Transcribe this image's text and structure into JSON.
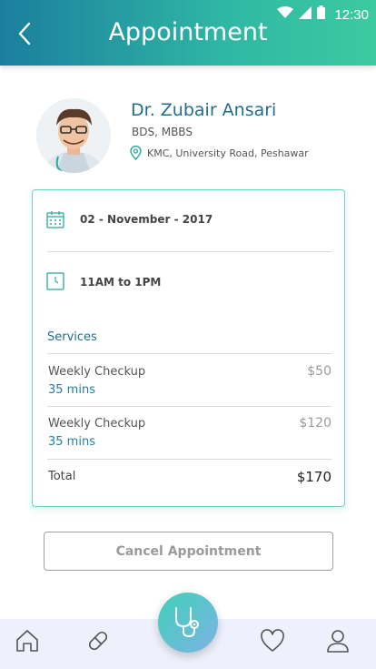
{
  "status_bar": {
    "time": "12:30"
  },
  "header": {
    "title": "Appointment"
  },
  "doctor": {
    "name": "Dr. Zubair Ansari",
    "degree": "BDS, MBBS",
    "location": "KMC, University Road, Peshawar"
  },
  "appointment": {
    "date": "02 - November - 2017",
    "time": "11AM to 1PM"
  },
  "services": {
    "title": "Services",
    "items": [
      {
        "name": "Weekly Checkup",
        "duration": "35 mins",
        "price": "$50"
      },
      {
        "name": "Weekly Checkup",
        "duration": "35 mins",
        "price": "$120"
      }
    ],
    "total_label": "Total",
    "total_value": "$170"
  },
  "actions": {
    "cancel_label": "Cancel Appointment"
  },
  "tabbar": {
    "items": [
      "home-icon",
      "pill-icon",
      "stethoscope-icon",
      "heart-icon",
      "user-icon"
    ]
  },
  "colors": {
    "accent": "#1f6f8b",
    "teal": "#3ccaa0",
    "card_border": "#6ad3c2"
  }
}
